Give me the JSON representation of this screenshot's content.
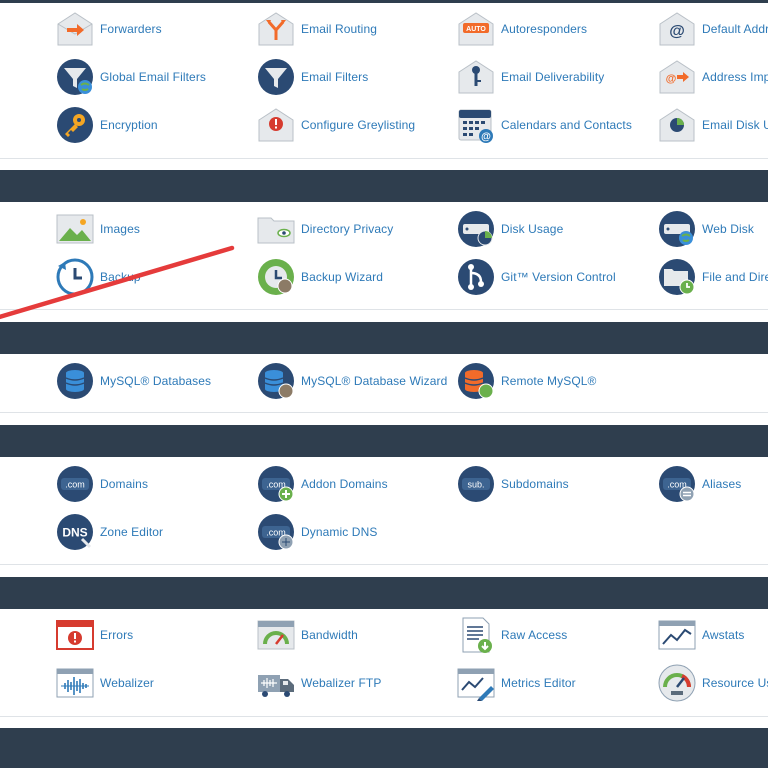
{
  "colors": {
    "band": "#2f3e4e",
    "link": "#2e7ab8",
    "icon_navy": "#2b4a73",
    "icon_envelope": "#e6e9ec",
    "accent_orange": "#f26b2a",
    "accent_green": "#6ab04c",
    "accent_red": "#d63b2f",
    "annotation_arrow": "#e53b3b"
  },
  "email": {
    "items": [
      {
        "label": "Forwarders",
        "icon": "envelope-forward-icon"
      },
      {
        "label": "Email Routing",
        "icon": "envelope-routing-icon"
      },
      {
        "label": "Autoresponders",
        "icon": "envelope-auto-icon"
      },
      {
        "label": "Default Addr",
        "icon": "envelope-at-icon"
      },
      {
        "label": "Global Email Filters",
        "icon": "global-filter-icon"
      },
      {
        "label": "Email Filters",
        "icon": "filter-icon"
      },
      {
        "label": "Email Deliverability",
        "icon": "envelope-key-icon"
      },
      {
        "label": "Address Imp",
        "icon": "envelope-import-icon"
      },
      {
        "label": "Encryption",
        "icon": "key-icon"
      },
      {
        "label": "Configure Greylisting",
        "icon": "envelope-alert-icon"
      },
      {
        "label": "Calendars and Contacts",
        "icon": "calendar-icon"
      },
      {
        "label": "Email Disk Us",
        "icon": "envelope-pie-icon"
      }
    ]
  },
  "files": {
    "items": [
      {
        "label": "Images",
        "icon": "image-icon"
      },
      {
        "label": "Directory Privacy",
        "icon": "folder-eye-icon"
      },
      {
        "label": "Disk Usage",
        "icon": "disk-usage-icon"
      },
      {
        "label": "Web Disk",
        "icon": "web-disk-icon"
      },
      {
        "label": "Backup",
        "icon": "backup-icon"
      },
      {
        "label": "Backup Wizard",
        "icon": "backup-wizard-icon"
      },
      {
        "label": "Git™ Version Control",
        "icon": "git-icon"
      },
      {
        "label": "File and Dire",
        "icon": "folder-restore-icon"
      }
    ]
  },
  "databases": {
    "items": [
      {
        "label": "MySQL® Databases",
        "icon": "database-icon"
      },
      {
        "label": "MySQL® Database Wizard",
        "icon": "database-wizard-icon"
      },
      {
        "label": "Remote MySQL®",
        "icon": "remote-database-icon"
      }
    ]
  },
  "domains": {
    "items": [
      {
        "label": "Domains",
        "icon": "domain-icon",
        "badge": ".com"
      },
      {
        "label": "Addon Domains",
        "icon": "addon-domain-icon",
        "badge": ".com"
      },
      {
        "label": "Subdomains",
        "icon": "subdomain-icon",
        "badge": "sub."
      },
      {
        "label": "Aliases",
        "icon": "alias-icon",
        "badge": ".com"
      },
      {
        "label": "Zone Editor",
        "icon": "dns-icon",
        "badge": "DNS"
      },
      {
        "label": "Dynamic DNS",
        "icon": "dynamic-dns-icon",
        "badge": ".com"
      }
    ]
  },
  "metrics": {
    "items": [
      {
        "label": "Errors",
        "icon": "errors-icon"
      },
      {
        "label": "Bandwidth",
        "icon": "bandwidth-icon"
      },
      {
        "label": "Raw Access",
        "icon": "raw-access-icon"
      },
      {
        "label": "Awstats",
        "icon": "awstats-icon"
      },
      {
        "label": "Webalizer",
        "icon": "webalizer-icon"
      },
      {
        "label": "Webalizer FTP",
        "icon": "webalizer-ftp-icon"
      },
      {
        "label": "Metrics Editor",
        "icon": "metrics-editor-icon"
      },
      {
        "label": "Resource Us",
        "icon": "resource-usage-icon"
      }
    ]
  }
}
